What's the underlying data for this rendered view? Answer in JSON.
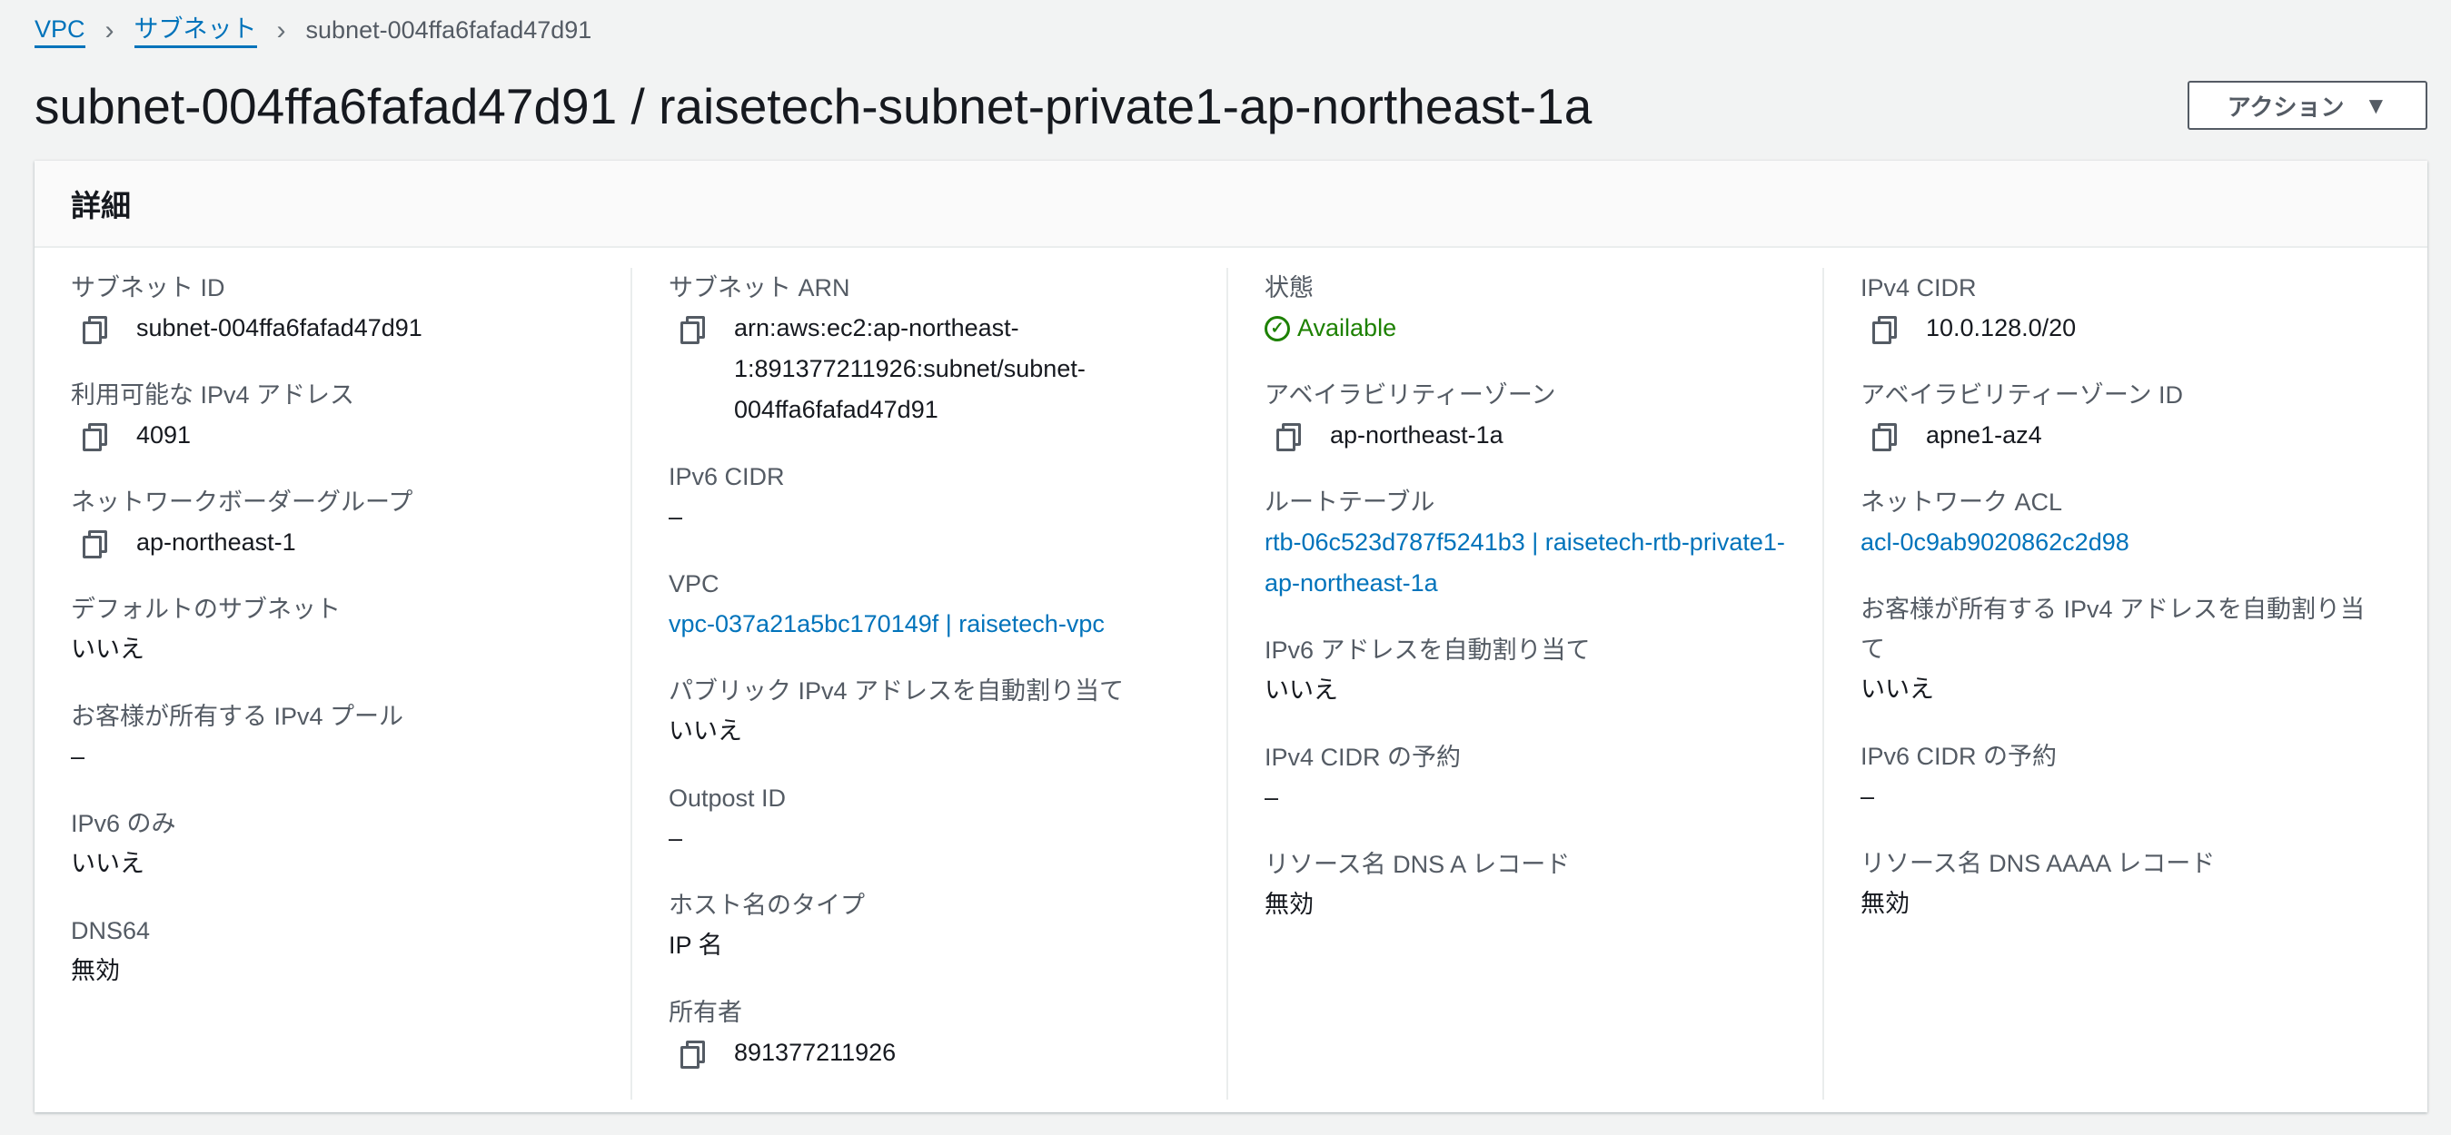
{
  "breadcrumb": {
    "vpc": "VPC",
    "subnets": "サブネット",
    "current": "subnet-004ffa6fafad47d91",
    "sep": "›"
  },
  "title": "subnet-004ffa6fafad47d91 / raisetech-subnet-private1-ap-northeast-1a",
  "action_button": {
    "label": "アクション",
    "caret": "▼"
  },
  "panel_title": "詳細",
  "columns": [
    [
      {
        "label": "サブネット ID",
        "value": "subnet-004ffa6fafad47d91",
        "copy": true
      },
      {
        "label": "利用可能な IPv4 アドレス",
        "value": "4091",
        "copy": true
      },
      {
        "label": "ネットワークボーダーグループ",
        "value": "ap-northeast-1",
        "copy": true
      },
      {
        "label": "デフォルトのサブネット",
        "value": "いいえ"
      },
      {
        "label": "お客様が所有する IPv4 プール",
        "value": "–"
      },
      {
        "label": "IPv6 のみ",
        "value": "いいえ"
      },
      {
        "label": "DNS64",
        "value": "無効"
      }
    ],
    [
      {
        "label": "サブネット ARN",
        "value": "arn:aws:ec2:ap-northeast-1:891377211926:subnet/subnet-004ffa6fafad47d91",
        "copy": true
      },
      {
        "label": "IPv6 CIDR",
        "value": "–"
      },
      {
        "label": "VPC",
        "value": "vpc-037a21a5bc170149f | raisetech-vpc",
        "link": true
      },
      {
        "label": "パブリック IPv4 アドレスを自動割り当て",
        "value": "いいえ"
      },
      {
        "label": "Outpost ID",
        "value": "–"
      },
      {
        "label": "ホスト名のタイプ",
        "value": "IP 名"
      },
      {
        "label": "所有者",
        "value": "891377211926",
        "copy": true
      }
    ],
    [
      {
        "label": "状態",
        "value": "Available",
        "status": true
      },
      {
        "label": "アベイラビリティーゾーン",
        "value": "ap-northeast-1a",
        "copy": true
      },
      {
        "label": "ルートテーブル",
        "value": "rtb-06c523d787f5241b3 | raisetech-rtb-private1-ap-northeast-1a",
        "link": true
      },
      {
        "label": "IPv6 アドレスを自動割り当て",
        "value": "いいえ"
      },
      {
        "label": "IPv4 CIDR の予約",
        "value": "–"
      },
      {
        "label": "リソース名 DNS A レコード",
        "value": "無効"
      }
    ],
    [
      {
        "label": "IPv4 CIDR",
        "value": "10.0.128.0/20",
        "copy": true
      },
      {
        "label": "アベイラビリティーゾーン ID",
        "value": "apne1-az4",
        "copy": true
      },
      {
        "label": "ネットワーク ACL",
        "value": "acl-0c9ab9020862c2d98",
        "link": true
      },
      {
        "label": "お客様が所有する IPv4 アドレスを自動割り当て",
        "value": "いいえ"
      },
      {
        "label": "IPv6 CIDR の予約",
        "value": "–"
      },
      {
        "label": "リソース名 DNS AAAA レコード",
        "value": "無効"
      }
    ]
  ],
  "colors": {
    "link": "#0073bb",
    "success": "#1d8102"
  }
}
